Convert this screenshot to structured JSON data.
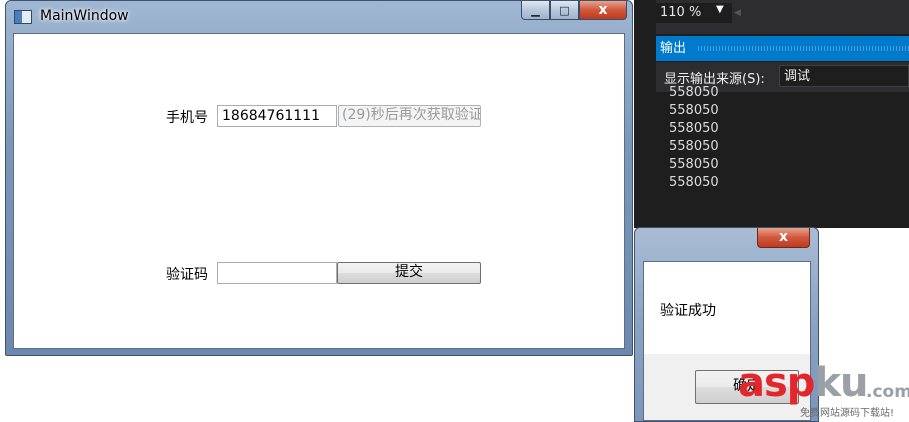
{
  "main_window": {
    "title": "MainWindow",
    "caption_minimize": "▁",
    "caption_maximize": "□",
    "caption_close": "x"
  },
  "form": {
    "phone_label": "手机号",
    "phone_value": "18684761111",
    "resend_label": "(29)秒后再次获取验证",
    "code_label": "验证码",
    "code_value": "",
    "submit_label": "提交"
  },
  "vs_output": {
    "zoom": "110 %",
    "pane_title": "输出",
    "source_label": "显示输出来源(S):",
    "source_value": "调试",
    "lines": [
      "558050",
      "558050",
      "558050",
      "558050",
      "558050",
      "558050"
    ],
    "accent_color": "#007acc"
  },
  "message_box": {
    "close_glyph": "x",
    "message": "验证成功",
    "ok_label": "确定"
  },
  "watermark": {
    "brand_red": "asp",
    "brand_gray": "ku",
    "brand_suffix": ".com",
    "tagline": "免费网站源码下载站!"
  }
}
